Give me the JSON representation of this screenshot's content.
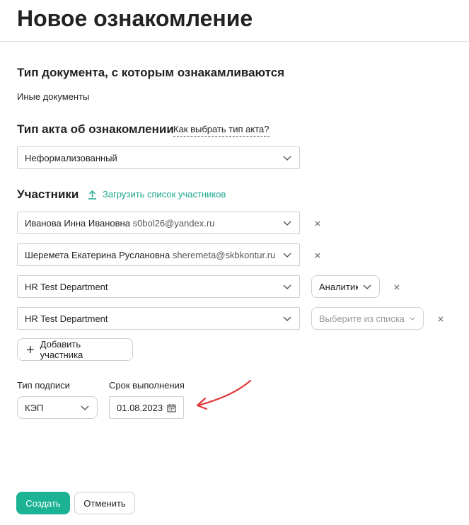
{
  "page": {
    "title": "Новое ознакомление"
  },
  "doc_type": {
    "heading": "Тип документа, с которым ознакамливаются",
    "value": "Иные документы"
  },
  "act_type": {
    "heading": "Тип акта об ознакомлении",
    "help_link": "Как выбрать тип акта?",
    "selected": "Неформализованный"
  },
  "participants": {
    "heading": "Участники",
    "upload_link": "Загрузить список участников",
    "rows": [
      {
        "name": "Иванова Инна Ивановна",
        "email": "s0bol26@yandex.ru"
      },
      {
        "name": "Шеремета Екатерина Руслановна",
        "email": "sheremeta@skbkontur.ru"
      },
      {
        "name": "HR Test Department",
        "role": "Аналитик"
      },
      {
        "name": "HR Test Department",
        "role_placeholder": "Выберите из списка"
      }
    ],
    "add_button": "Добавить участника"
  },
  "signature": {
    "label": "Тип подписи",
    "value": "КЭП"
  },
  "deadline": {
    "label": "Срок выполнения",
    "value": "01.08.2023"
  },
  "actions": {
    "create": "Создать",
    "cancel": "Отменить"
  },
  "colors": {
    "accent": "#1cb394",
    "link_green": "#1aa78e",
    "arrow": "#e03a3a"
  }
}
